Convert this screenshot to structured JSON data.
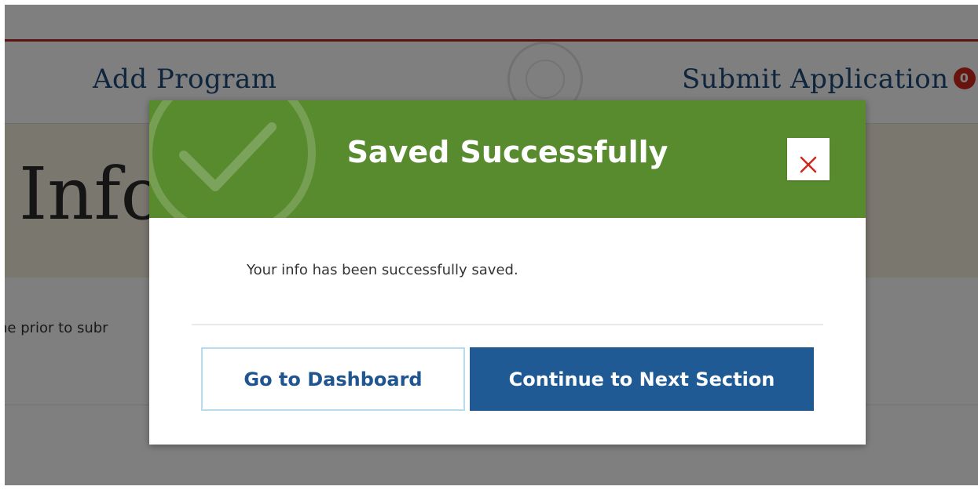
{
  "nav": {
    "add_program": "Add Program",
    "submit_application": "Submit Application",
    "submit_badge_count": "0"
  },
  "banner": {
    "title_visible": "Info"
  },
  "page_body": {
    "text_visible": "ne prior to subr"
  },
  "modal": {
    "title": "Saved Successfully",
    "message": "Your info has been successfully saved.",
    "close_icon": "close-x-icon",
    "header_icon": "checkmark-icon",
    "buttons": {
      "dashboard": "Go to Dashboard",
      "next": "Continue to Next Section"
    }
  },
  "colors": {
    "header_green": "#588a2e",
    "primary_blue": "#205a95",
    "close_red": "#d0261d",
    "nav_link_blue": "#1d4b7a",
    "top_rule_red": "#b52a22"
  }
}
